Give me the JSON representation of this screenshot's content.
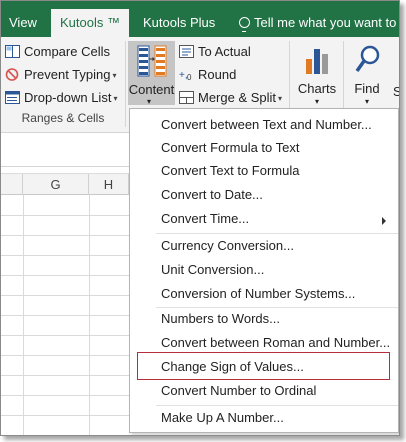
{
  "tabs": {
    "view": "View",
    "kutools": "Kutools ™",
    "kutools_plus": "Kutools Plus",
    "tell_me": "Tell me what you want to d"
  },
  "ribbon": {
    "compare_cells": "Compare Cells",
    "prevent_typing": "Prevent Typing",
    "dropdown_list": "Drop-down List",
    "group_label": "Ranges & Cells",
    "content": "Content",
    "to_actual": "To Actual",
    "round": "Round",
    "merge_split": "Merge & Split",
    "charts": "Charts",
    "find": "Find",
    "s_partial": "S"
  },
  "grid": {
    "columns": [
      "G",
      "H"
    ]
  },
  "menu": {
    "items": [
      "Convert between Text and Number...",
      "Convert Formula to Text",
      "Convert Text to Formula",
      "Convert to Date...",
      "Convert Time...",
      "Currency Conversion...",
      "Unit Conversion...",
      "Conversion of Number Systems...",
      "Numbers to Words...",
      "Convert between Roman and Number...",
      "Change Sign of Values...",
      "Convert Number to Ordinal",
      "Make Up A Number..."
    ]
  },
  "colors": {
    "accent": "#217346",
    "highlight_box": "#b3303a",
    "ribbon_bg": "#f3f3f3"
  },
  "icons": [
    "compare-cells-icon",
    "prevent-typing-icon",
    "dropdown-list-icon",
    "content-icon",
    "to-actual-icon",
    "round-icon",
    "merge-split-icon",
    "charts-icon",
    "find-icon",
    "lightbulb-icon",
    "submenu-arrow-icon"
  ]
}
